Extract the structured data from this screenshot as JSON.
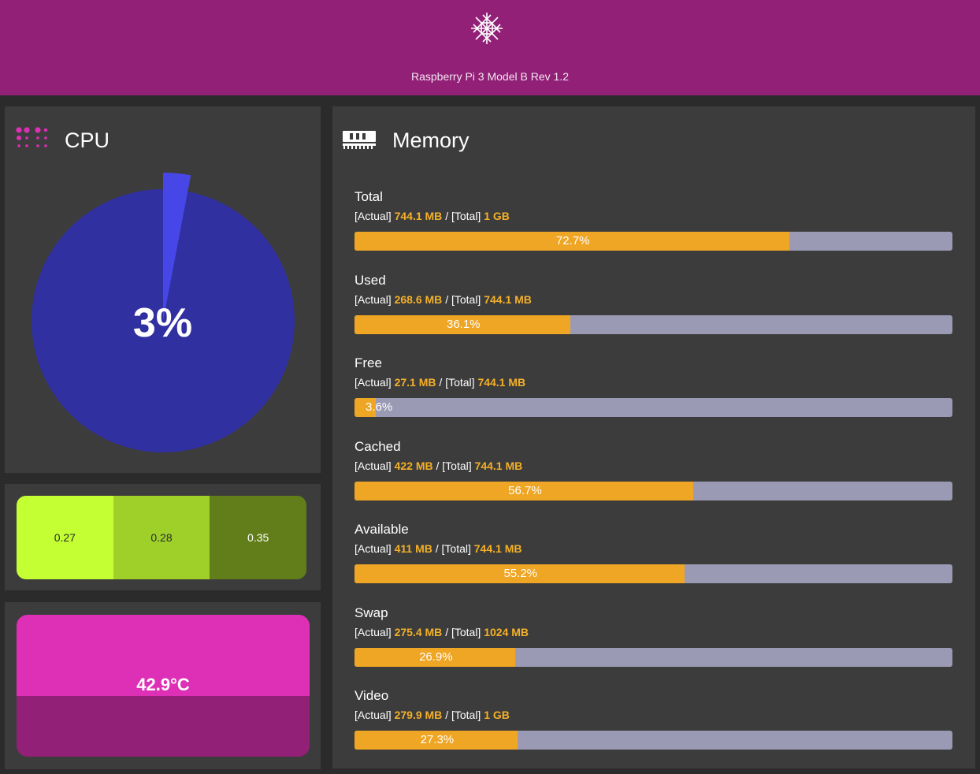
{
  "header": {
    "device_name": "Raspberry Pi 3 Model B Rev 1.2",
    "logo_icon": "flower-logo-icon"
  },
  "cpu": {
    "title": "CPU",
    "icon": "cpu-dots-icon",
    "usage_percent": 3,
    "usage_label": "3%",
    "colors": {
      "used": "#4747e8",
      "idle": "#3030a0"
    }
  },
  "load_average": {
    "values": [
      "0.27",
      "0.28",
      "0.35"
    ],
    "colors": [
      "#c3ff33",
      "#9fd02a",
      "#627e1a"
    ]
  },
  "temperature": {
    "value_label": "42.9°C",
    "colors": {
      "top": "#de30b6",
      "bottom": "#922077"
    }
  },
  "memory": {
    "title": "Memory",
    "icon": "ram-stick-icon",
    "actual_tag": "[Actual]",
    "total_tag": "[Total]",
    "separator": "/",
    "items": [
      {
        "name": "Total",
        "actual": "744.1 MB",
        "total": "1 GB",
        "percent": 72.7,
        "percent_label": "72.7%"
      },
      {
        "name": "Used",
        "actual": "268.6 MB",
        "total": "744.1 MB",
        "percent": 36.1,
        "percent_label": "36.1%"
      },
      {
        "name": "Free",
        "actual": "27.1 MB",
        "total": "744.1 MB",
        "percent": 3.6,
        "percent_label": "3.6%"
      },
      {
        "name": "Cached",
        "actual": "422 MB",
        "total": "744.1 MB",
        "percent": 56.7,
        "percent_label": "56.7%"
      },
      {
        "name": "Available",
        "actual": "411 MB",
        "total": "744.1 MB",
        "percent": 55.2,
        "percent_label": "55.2%"
      },
      {
        "name": "Swap",
        "actual": "275.4 MB",
        "total": "1024 MB",
        "percent": 26.9,
        "percent_label": "26.9%"
      },
      {
        "name": "Video",
        "actual": "279.9 MB",
        "total": "1 GB",
        "percent": 27.3,
        "percent_label": "27.3%"
      }
    ],
    "colors": {
      "fill": "#efa624",
      "track": "#9b9ab5",
      "value": "#f4b028"
    }
  }
}
